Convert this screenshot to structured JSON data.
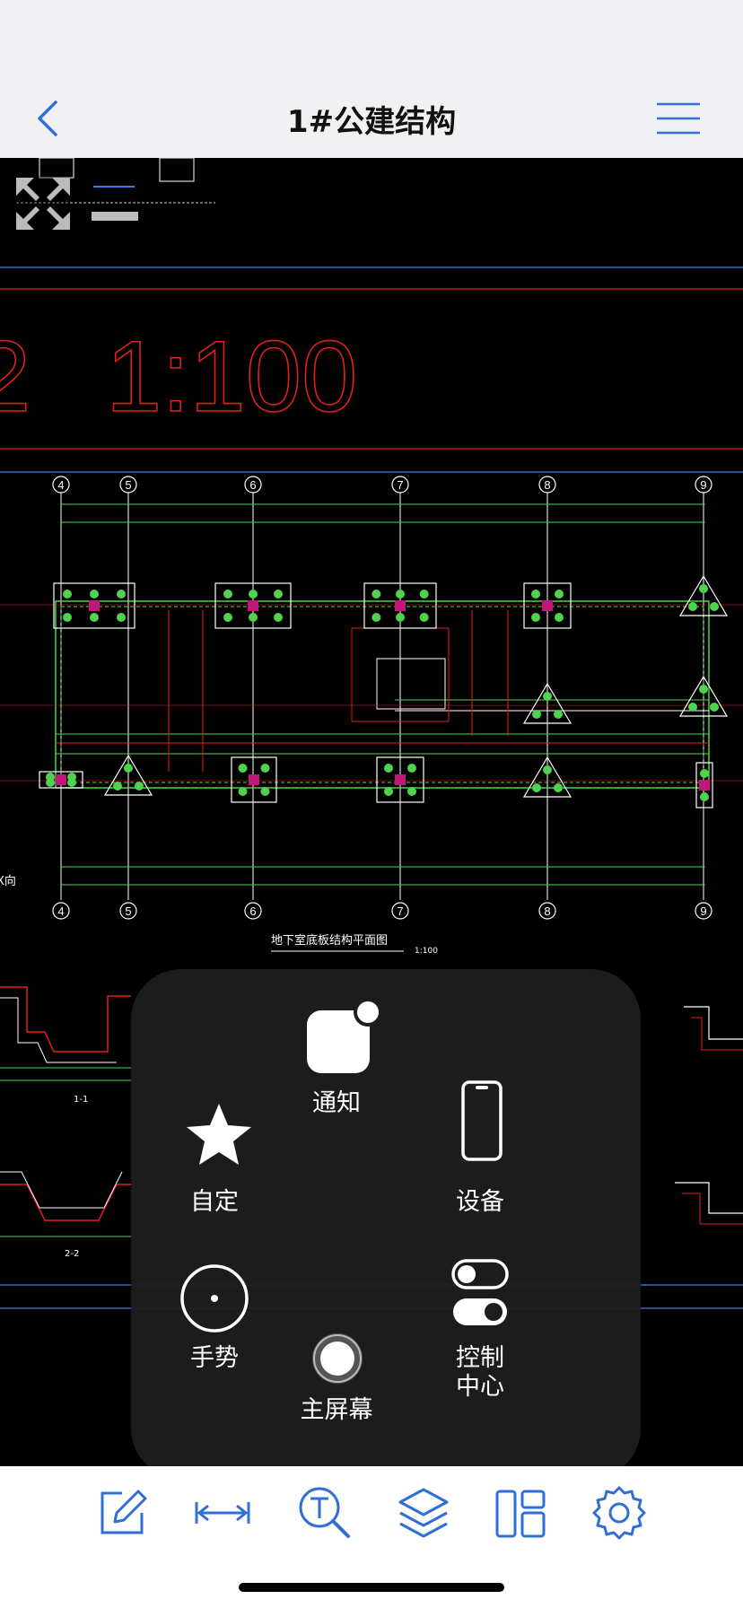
{
  "header": {
    "title": "1#公建结构"
  },
  "drawing": {
    "scale_label": "1:100",
    "plan_title": "地下室底板结构平面图",
    "plan_scale": "1:100",
    "axis_labels": [
      "4",
      "5",
      "6",
      "7",
      "8",
      "9"
    ],
    "section_labels": [
      "1-1",
      "2-2"
    ],
    "side_text": "X向"
  },
  "assistive_touch": {
    "items": {
      "notification": "通知",
      "custom": "自定",
      "device": "设备",
      "gesture": "手势",
      "control_center": "控制\n中心",
      "home": "主屏幕"
    }
  },
  "toolbar": {
    "icons": [
      "edit-icon",
      "measure-icon",
      "text-search-icon",
      "layers-icon",
      "layout-icon",
      "settings-icon"
    ]
  },
  "colors": {
    "accent": "#2f6fd6",
    "cad_red": "#e0201c",
    "cad_green": "#4fd34f",
    "cad_blue": "#3a7fe0"
  }
}
